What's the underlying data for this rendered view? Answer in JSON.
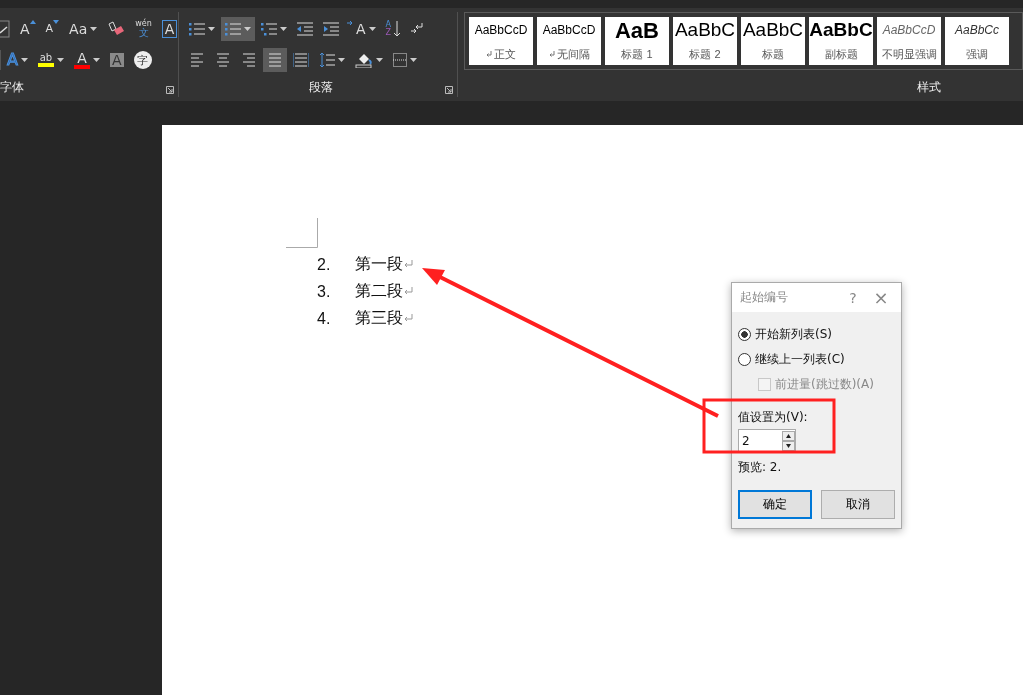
{
  "ribbon": {
    "font_group": {
      "label": "字体",
      "row1": [
        {
          "kind": "partial"
        },
        {
          "kind": "grow",
          "glyph": "A"
        },
        {
          "kind": "shrink",
          "glyph": "A"
        },
        {
          "kind": "case",
          "glyph": "Aa",
          "dropdown": true
        },
        {
          "kind": "eraser"
        },
        {
          "kind": "phonetic",
          "glyph": "wén",
          "glyph2": "文"
        },
        {
          "kind": "border",
          "glyph": "A"
        }
      ],
      "row2": [
        {
          "kind": "effects",
          "glyph": "A",
          "dropdown": true
        },
        {
          "kind": "highlight",
          "glyph": "ab",
          "dropdown": true
        },
        {
          "kind": "color",
          "glyph": "A",
          "dropdown": true
        },
        {
          "kind": "shade",
          "glyph": "A"
        },
        {
          "kind": "enclose",
          "glyph": "字"
        }
      ]
    },
    "paragraph_group": {
      "label": "段落",
      "row1": [
        {
          "kind": "bullets",
          "dropdown": true,
          "selected": false
        },
        {
          "kind": "numbering",
          "dropdown": true,
          "selected": true
        },
        {
          "kind": "multilevel",
          "dropdown": true,
          "selected": false
        },
        {
          "kind": "outdent",
          "selected": false
        },
        {
          "kind": "indent",
          "selected": false
        },
        {
          "kind": "asian",
          "glyph": "A",
          "dropdown": true,
          "selected": false
        },
        {
          "kind": "sort",
          "glyph": "A",
          "glyph2": "Z",
          "selected": false
        },
        {
          "kind": "marks",
          "selected": false
        }
      ],
      "row2": [
        {
          "kind": "left",
          "selected": false
        },
        {
          "kind": "center",
          "selected": false
        },
        {
          "kind": "right",
          "selected": false
        },
        {
          "kind": "justify",
          "selected": true
        },
        {
          "kind": "distributed",
          "selected": false
        },
        {
          "kind": "spacing",
          "dropdown": true,
          "selected": false
        },
        {
          "kind": "fill",
          "dropdown": true,
          "selected": false
        },
        {
          "kind": "borders",
          "dropdown": true,
          "selected": false
        }
      ]
    },
    "styles_group": {
      "label": "样式",
      "styles": [
        {
          "preview": "AaBbCcD",
          "name": "正文",
          "mark": true,
          "kind": "normal"
        },
        {
          "preview": "AaBbCcD",
          "name": "无间隔",
          "mark": true,
          "kind": "normal"
        },
        {
          "preview": "AaB",
          "name": "标题 1",
          "mark": false,
          "kind": "h1"
        },
        {
          "preview": "AaBbC",
          "name": "标题 2",
          "mark": false,
          "kind": "h2"
        },
        {
          "preview": "AaBbC",
          "name": "标题",
          "mark": false,
          "kind": "title"
        },
        {
          "preview": "AaBbC",
          "name": "副标题",
          "mark": false,
          "kind": "subtitle"
        },
        {
          "preview": "AaBbCcD",
          "name": "不明显强调",
          "mark": false,
          "kind": "subtle"
        },
        {
          "preview": "AaBbCc",
          "name": "强调",
          "mark": false,
          "kind": "emphasis"
        }
      ]
    }
  },
  "document": {
    "list": [
      {
        "number": "2.",
        "text": "第一段"
      },
      {
        "number": "3.",
        "text": "第二段"
      },
      {
        "number": "4.",
        "text": "第三段"
      }
    ]
  },
  "dialog": {
    "title": "起始编号",
    "help": "?",
    "close": "×",
    "options": [
      {
        "label": "开始新列表(S)",
        "selected": true
      },
      {
        "label": "继续上一列表(C)",
        "selected": false
      }
    ],
    "advance": {
      "label": "前进量(跳过数)(A)",
      "checked": false,
      "disabled": true
    },
    "value_label": "值设置为(V):",
    "value": "2",
    "preview": "预览: 2.",
    "buttons": [
      {
        "label": "确定",
        "default": true
      },
      {
        "label": "取消",
        "default": false
      }
    ]
  }
}
